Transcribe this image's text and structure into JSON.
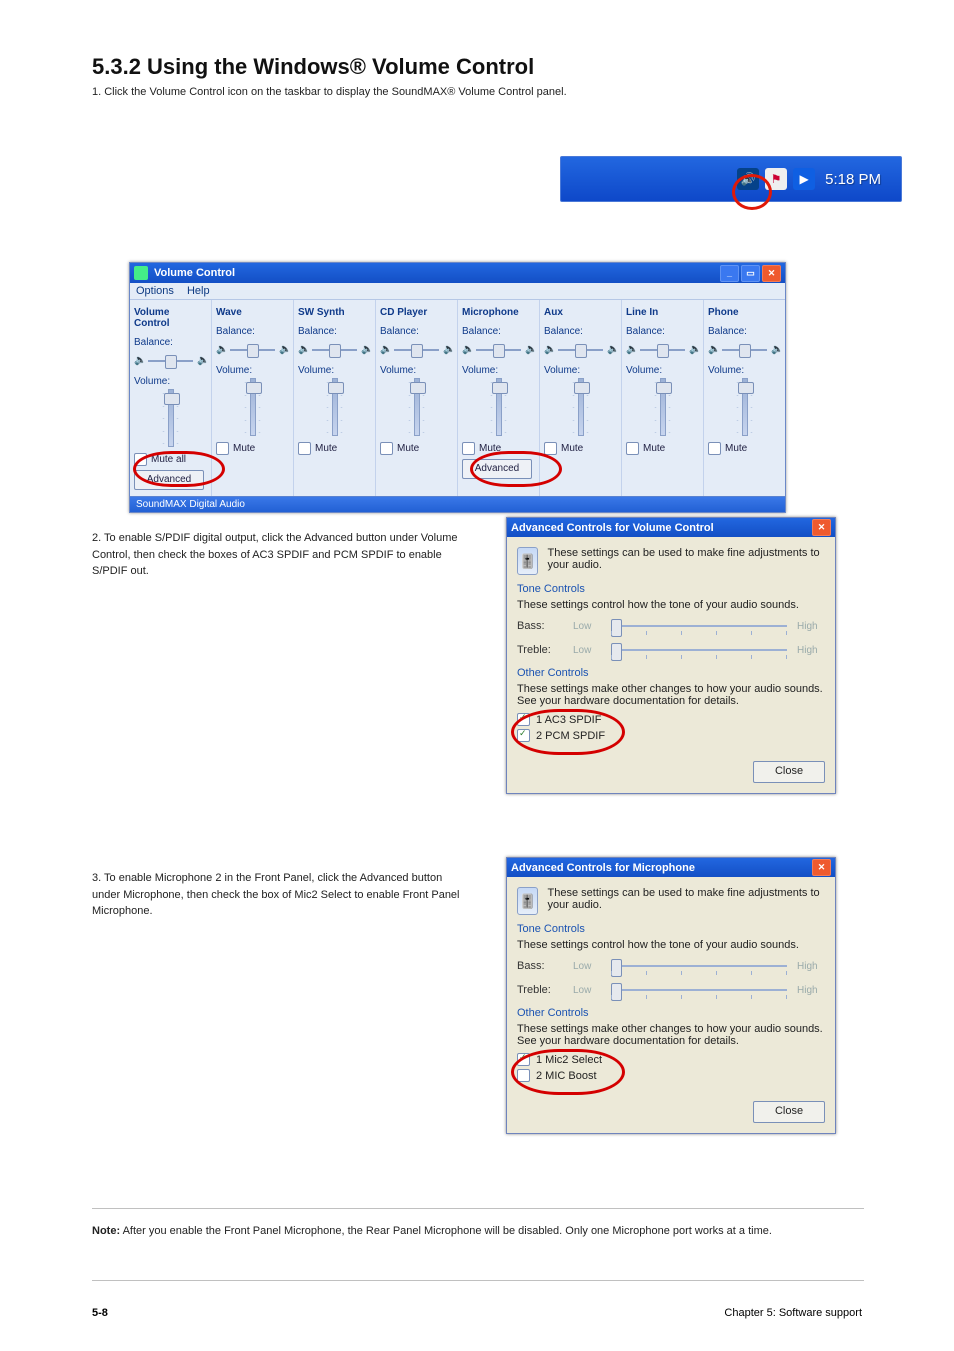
{
  "page": {
    "title": "5.3.2 Using the Windows® Volume Control",
    "sub_1": "1. Click the Volume Control icon on the taskbar to display the SoundMAX® Volume Control panel.",
    "tray_time": "5:18 PM",
    "step2": "2. To enable S/PDIF digital output, click the Advanced button under Volume Control, then check the boxes of AC3 SPDIF and PCM SPDIF to enable S/PDIF out.",
    "step3": "3. To enable Microphone 2 in the Front Panel, click the Advanced button under Microphone, then check the box of Mic2 Select to enable Front Panel Microphone.",
    "note_bold": "Note:",
    "note": "After you enable the Front Panel Microphone, the Rear Panel Microphone will be disabled. Only one Microphone port works at a time.",
    "footer_left": "5-8",
    "footer_right": "Chapter 5: Software support"
  },
  "mixer": {
    "title": "Volume Control",
    "menu": {
      "opt": "Options",
      "help": "Help"
    },
    "balance": "Balance:",
    "volume": "Volume:",
    "mute_all": "Mute all",
    "mute": "Mute",
    "advanced": "Advanced",
    "status": "SoundMAX Digital Audio",
    "channels": [
      {
        "name": "Volume Control",
        "mute_label": "mute_all",
        "adv": true
      },
      {
        "name": "Wave",
        "mute_label": "mute"
      },
      {
        "name": "SW Synth",
        "mute_label": "mute"
      },
      {
        "name": "CD Player",
        "mute_label": "mute"
      },
      {
        "name": "Microphone",
        "mute_label": "mute",
        "adv": true
      },
      {
        "name": "Aux",
        "mute_label": "mute"
      },
      {
        "name": "Line In",
        "mute_label": "mute"
      },
      {
        "name": "Phone",
        "mute_label": "mute"
      }
    ]
  },
  "advVol": {
    "title": "Advanced Controls for Volume Control",
    "intro": "These settings can be used to make fine adjustments to your audio.",
    "tone": "Tone Controls",
    "tone_desc": "These settings control how the tone of your audio sounds.",
    "bass": "Bass:",
    "treble": "Treble:",
    "low": "Low",
    "high": "High",
    "other": "Other Controls",
    "other_desc": "These settings make other changes to how your audio sounds. See your hardware documentation for details.",
    "c1": "1  AC3 SPDIF",
    "c2": "2  PCM SPDIF",
    "close": "Close"
  },
  "advMic": {
    "title": "Advanced Controls for Microphone",
    "intro": "These settings can be used to make fine adjustments to your audio.",
    "tone": "Tone Controls",
    "tone_desc": "These settings control how the tone of your audio sounds.",
    "bass": "Bass:",
    "treble": "Treble:",
    "low": "Low",
    "high": "High",
    "other": "Other Controls",
    "other_desc": "These settings make other changes to how your audio sounds. See your hardware documentation for details.",
    "c1": "1  Mic2 Select",
    "c2": "2  MIC Boost",
    "close": "Close"
  }
}
